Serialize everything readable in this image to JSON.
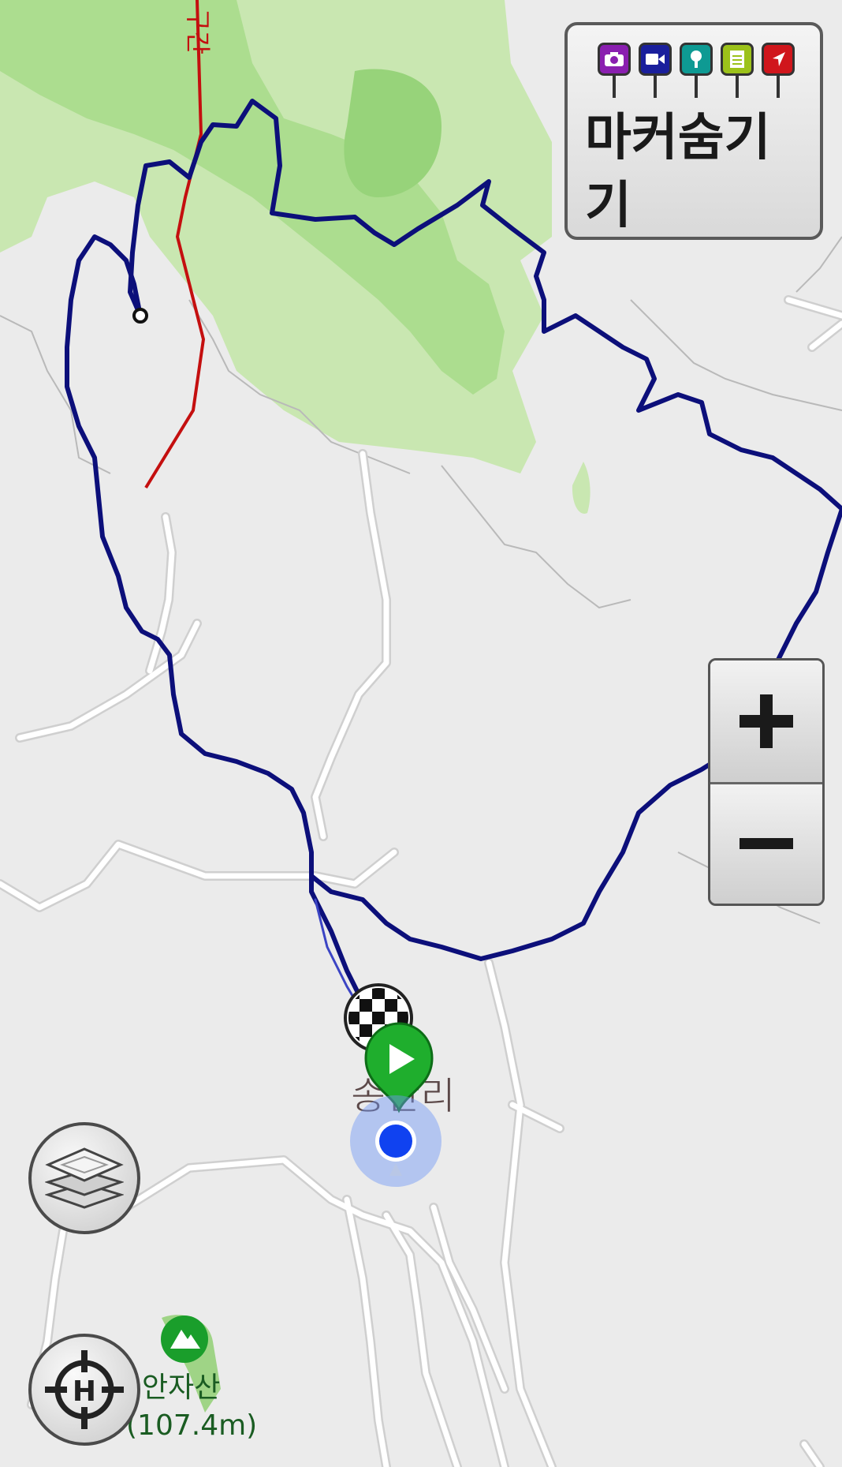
{
  "map": {
    "road_label_top": "구간",
    "village_label": "송산리",
    "mountain_name": "안자산",
    "mountain_elevation": "(107.4m)"
  },
  "marker_panel": {
    "label": "마커숨기기",
    "icons": [
      {
        "name": "camera-marker-icon",
        "color": "#8a1fb0"
      },
      {
        "name": "video-marker-icon",
        "color": "#1a1f9c"
      },
      {
        "name": "voice-marker-icon",
        "color": "#0e9a93"
      },
      {
        "name": "memo-marker-icon",
        "color": "#9cc21a"
      },
      {
        "name": "waypoint-marker-icon",
        "color": "#d0161c"
      }
    ]
  },
  "zoom": {
    "in_icon": "plus-icon",
    "out_icon": "minus-icon"
  },
  "buttons": {
    "layers_icon": "layers-icon",
    "home_icon": "home-crosshair-icon"
  },
  "colors": {
    "track": "#0c0f7a",
    "route": "#c40f0f",
    "forest": "#c6e6ad",
    "road": "#ffffff",
    "land": "#ebebeb"
  }
}
